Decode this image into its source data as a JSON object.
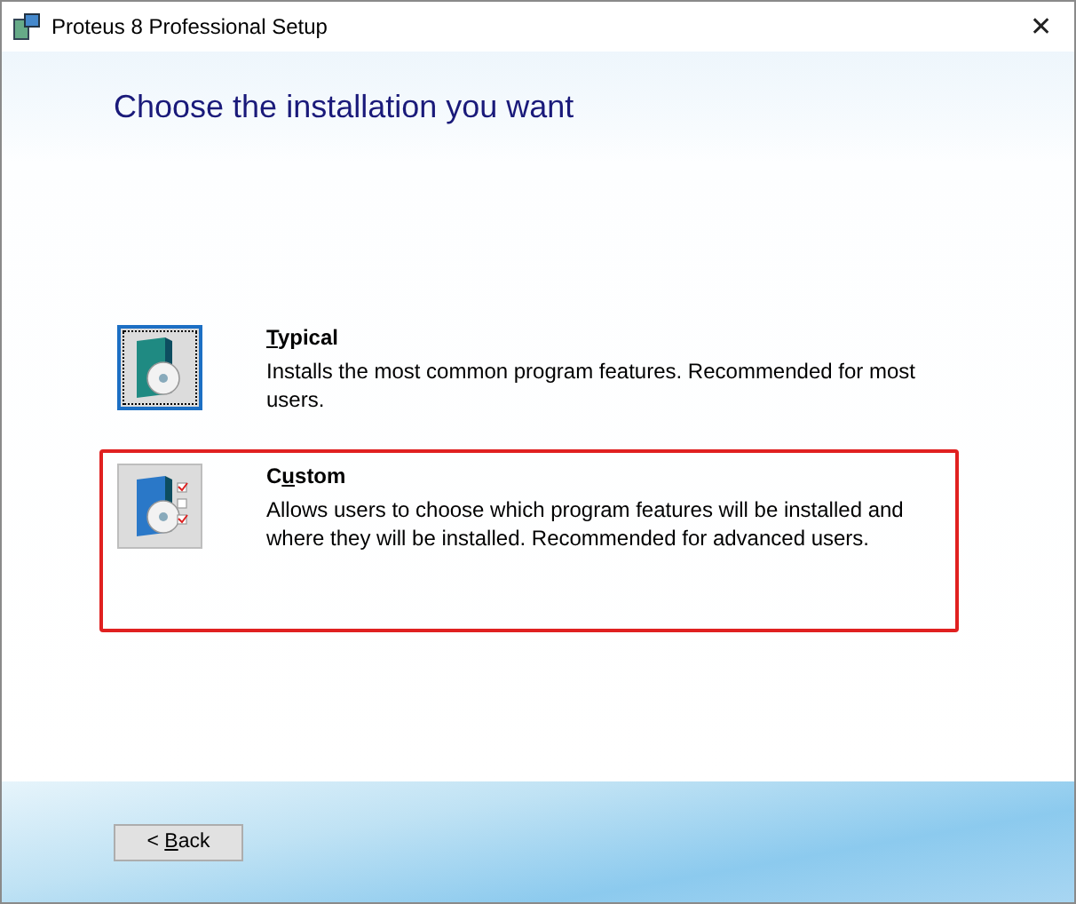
{
  "window": {
    "title": "Proteus 8 Professional Setup",
    "close": "✕"
  },
  "heading": "Choose the installation you want",
  "options": [
    {
      "kind": "typical",
      "label": {
        "key": "T",
        "post": "ypical"
      },
      "description": "Installs the most common program features. Recommended for most users.",
      "focused": true,
      "highlighted": false
    },
    {
      "kind": "custom",
      "label": {
        "pre": "C",
        "key": "u",
        "post": "stom"
      },
      "description": "Allows users to choose which program features will be installed and where they will be installed. Recommended for advanced users.",
      "focused": false,
      "highlighted": true
    }
  ],
  "back_button": {
    "pre": "< ",
    "key": "B",
    "post": "ack"
  }
}
